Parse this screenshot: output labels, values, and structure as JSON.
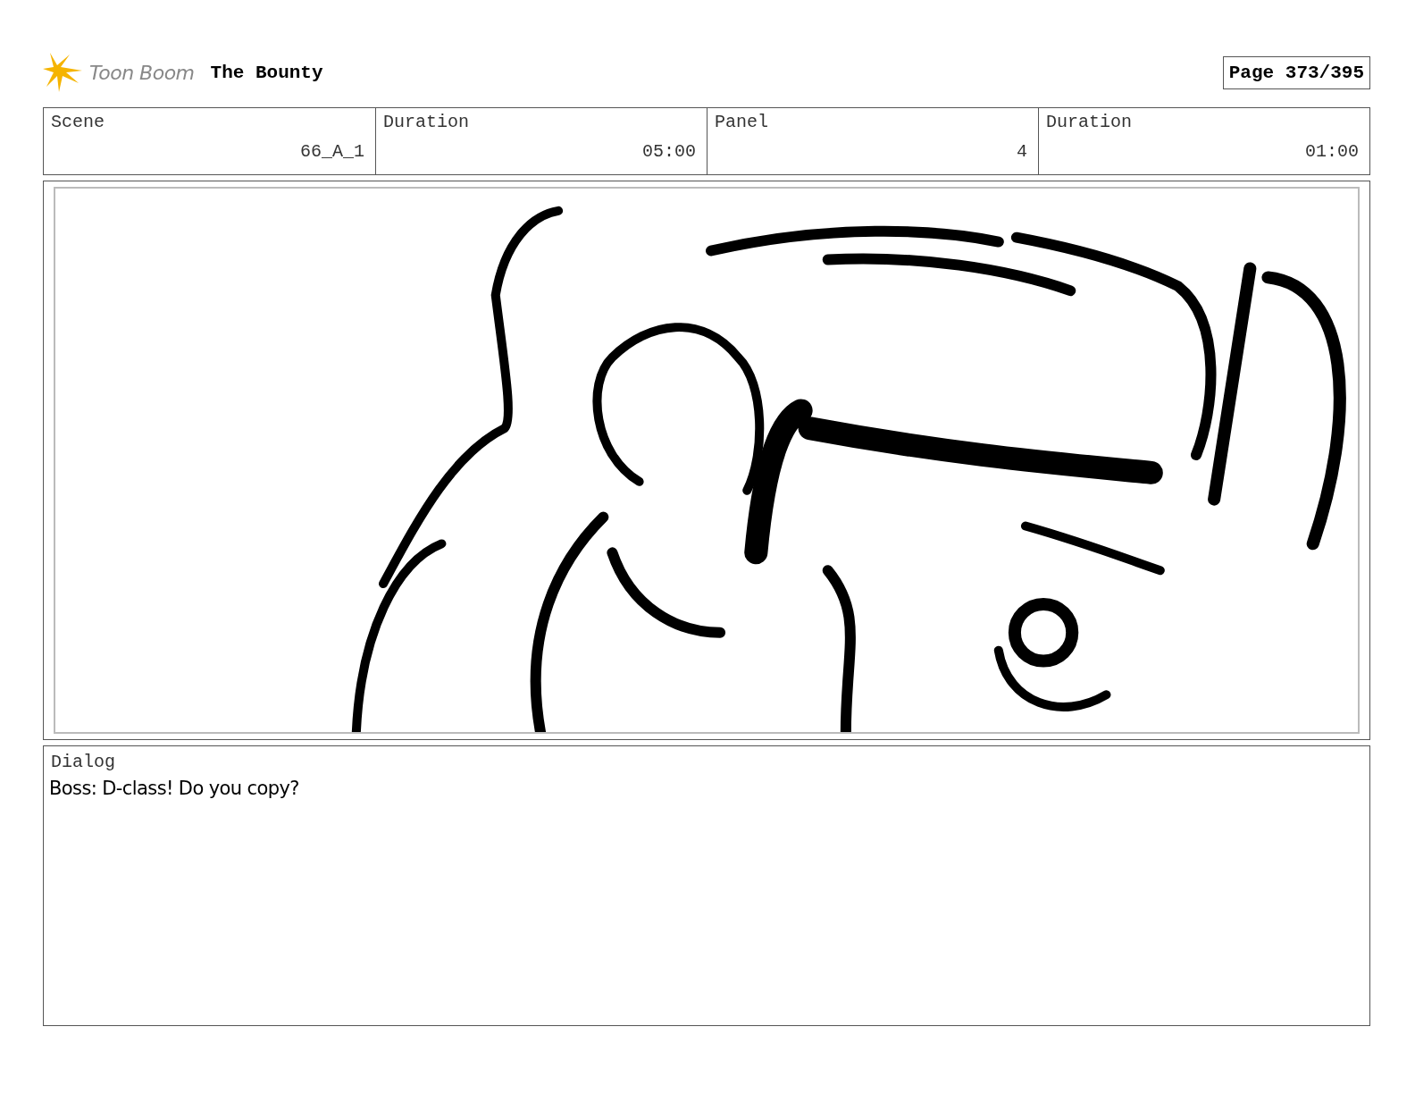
{
  "header": {
    "logo_text": "Toon Boom",
    "title": "The Bounty",
    "page": "Page 373/395"
  },
  "fields": [
    {
      "label": "Scene",
      "value": "66_A_1"
    },
    {
      "label": "Duration",
      "value": "05:00"
    },
    {
      "label": "Panel",
      "value": "4"
    },
    {
      "label": "Duration",
      "value": "01:00"
    }
  ],
  "dialog": {
    "label": "Dialog",
    "text": "Boss: D-class! Do you copy?"
  }
}
